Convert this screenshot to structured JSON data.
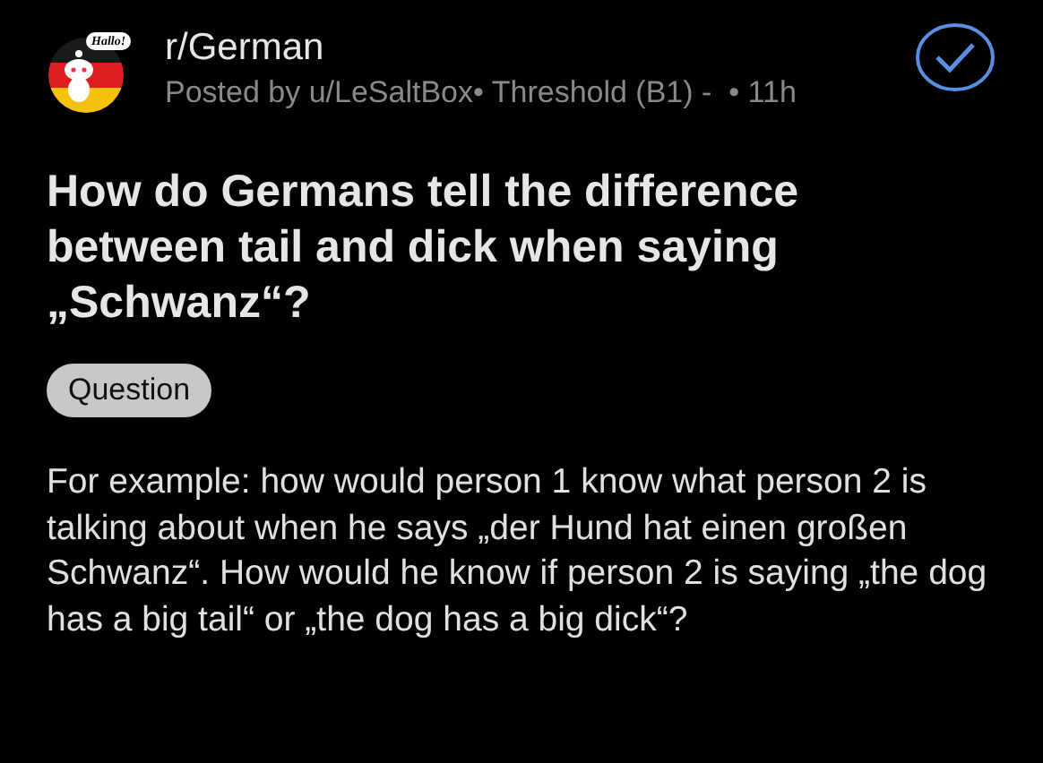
{
  "post": {
    "subreddit": "r/German",
    "subreddit_icon_bubble": "Hallo!",
    "meta": "Posted by u/LeSaltBox• Threshold (B1) -  • 11h",
    "title": "How do Germans tell the difference between tail and dick when saying „Schwanz“?",
    "flair": "Question",
    "body": "For example: how would person 1 know what person 2 is talking about when he says „der Hund hat einen großen Schwanz“. How would he know if person 2 is saying „the dog has a big tail“ or „the dog has a big dick“?"
  }
}
